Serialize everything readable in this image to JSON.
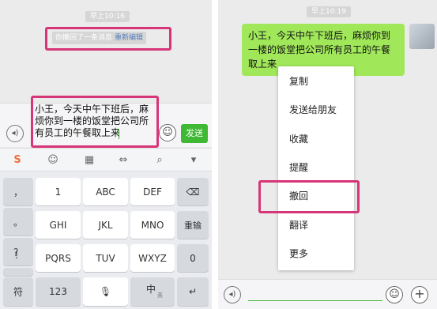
{
  "left": {
    "time": "早上10:16",
    "recall_notice": "你撤回了一条消息",
    "reedit_link": "重新编辑",
    "input_text": "小王，今天中午下班后，麻烦你到一楼的饭堂把公司所有员工的午餐取上来",
    "send_label": "发送",
    "toolbar": {
      "icons": [
        "sogou-logo-icon",
        "emoji-icon",
        "keyboard-icon",
        "cursor-move-icon",
        "search-icon",
        "collapse-icon"
      ]
    },
    "keys": {
      "row1": [
        "，",
        "1",
        "ABC",
        "DEF"
      ],
      "row2": [
        "。",
        "GHI",
        "JKL",
        "MNO"
      ],
      "row2_right": "重输",
      "row3": [
        "？",
        "PQRS",
        "TUV",
        "WXYZ"
      ],
      "row3_right": "0",
      "row4": [
        "！"
      ],
      "bottom": {
        "symbol": "符",
        "num": "123",
        "lang": "中",
        "lang_sub": "英"
      }
    }
  },
  "right": {
    "time": "早上10:19",
    "message": "小王，今天中午下班后，麻烦你到一楼的饭堂把公司所有员工的午餐取上来",
    "menu": [
      "复制",
      "发送给朋友",
      "收藏",
      "提醒",
      "撤回",
      "翻译",
      "更多"
    ]
  },
  "colors": {
    "highlight": "#d63577",
    "send_green": "#3fb833",
    "bubble_green": "#a0e75a",
    "link_blue": "#577fbd"
  }
}
